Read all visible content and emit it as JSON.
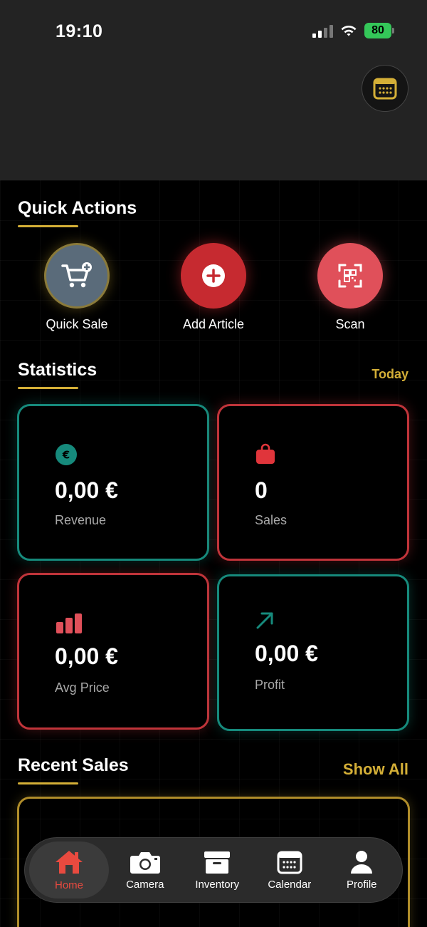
{
  "status_bar": {
    "time": "19:10",
    "battery": "80"
  },
  "header": {
    "calendar_icon": "calendar-icon"
  },
  "quick_actions": {
    "title": "Quick Actions",
    "items": [
      {
        "label": "Quick Sale",
        "icon": "cart-plus-icon",
        "color": "#5a6b7a"
      },
      {
        "label": "Add Article",
        "icon": "plus-circle-icon",
        "color": "#c62a30"
      },
      {
        "label": "Scan",
        "icon": "qr-code-icon",
        "color": "#e0505a"
      }
    ]
  },
  "statistics": {
    "title": "Statistics",
    "period": "Today",
    "cards": [
      {
        "value": "0,00 €",
        "label": "Revenue",
        "icon": "euro-icon",
        "accent": "#168a7c"
      },
      {
        "value": "0",
        "label": "Sales",
        "icon": "shopping-bag-icon",
        "accent": "#c0343a"
      },
      {
        "value": "0,00 €",
        "label": "Avg Price",
        "icon": "bar-chart-icon",
        "accent": "#c0343a"
      },
      {
        "value": "0,00 €",
        "label": "Profit",
        "icon": "arrow-up-right-icon",
        "accent": "#168a7c"
      }
    ]
  },
  "recent_sales": {
    "title": "Recent Sales",
    "show_all": "Show All"
  },
  "nav": {
    "items": [
      {
        "label": "Home",
        "icon": "home-icon",
        "active": true
      },
      {
        "label": "Camera",
        "icon": "camera-icon"
      },
      {
        "label": "Inventory",
        "icon": "archive-box-icon"
      },
      {
        "label": "Calendar",
        "icon": "calendar-icon"
      },
      {
        "label": "Profile",
        "icon": "person-icon"
      }
    ]
  },
  "colors": {
    "accent_gold": "#d4af37",
    "teal": "#168a7c",
    "red": "#c0343a",
    "active_red": "#e84a3f"
  }
}
